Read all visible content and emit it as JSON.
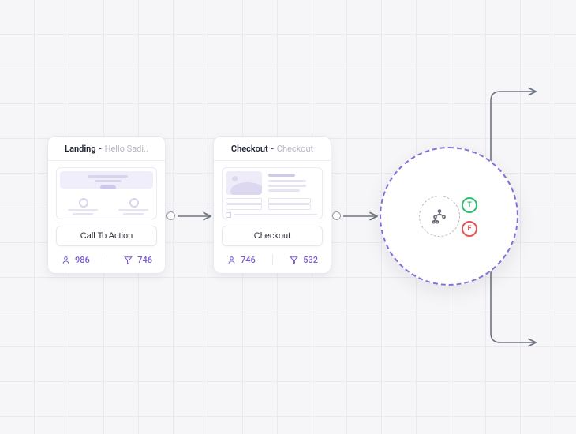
{
  "nodes": {
    "landing": {
      "title_prefix": "Landing",
      "title_suffix": "Hello Sadi..",
      "cta": "Call To Action",
      "users": "986",
      "filtered": "746"
    },
    "checkout": {
      "title_prefix": "Checkout",
      "title_suffix": "Checkout",
      "cta": "Checkout",
      "users": "746",
      "filtered": "532"
    }
  },
  "decision": {
    "true_label": "T",
    "false_label": "F"
  }
}
